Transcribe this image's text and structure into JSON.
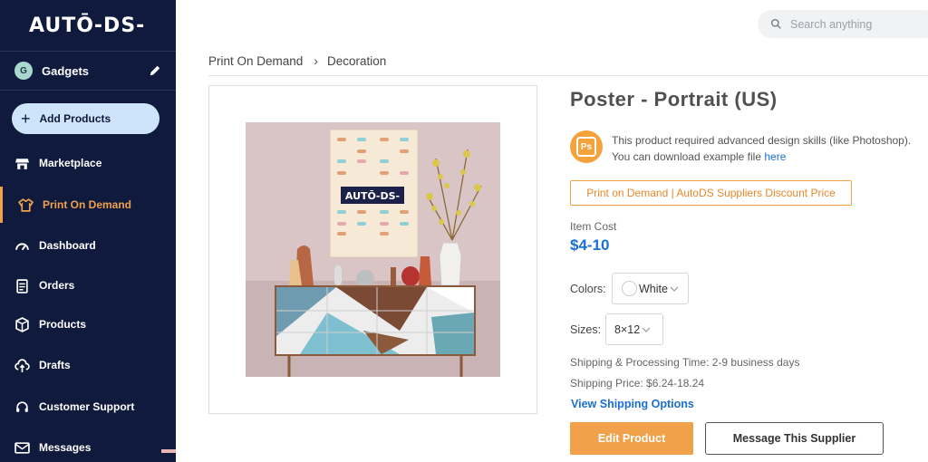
{
  "app": {
    "logo_text": "AUTŌ-DS-"
  },
  "colors": {
    "sidebar_bg": "#0f1a3d",
    "accent_orange": "#f0a14a",
    "link_blue": "#1a6fd6",
    "add_button_bg": "#cde4fb"
  },
  "sidebar": {
    "store_avatar": "G",
    "store_name": "Gadgets",
    "add_products_label": "Add Products",
    "items": [
      {
        "label": "Marketplace",
        "icon": "store-icon",
        "active": false
      },
      {
        "label": "Print On Demand",
        "icon": "shirt-icon",
        "active": true
      },
      {
        "label": "Dashboard",
        "icon": "gauge-icon",
        "active": false
      },
      {
        "label": "Orders",
        "icon": "clipboard-icon",
        "active": false
      },
      {
        "label": "Products",
        "icon": "box-icon",
        "active": false
      },
      {
        "label": "Drafts",
        "icon": "cloud-upload-icon",
        "active": false
      },
      {
        "label": "Customer Support",
        "icon": "headset-icon",
        "active": false
      },
      {
        "label": "Messages",
        "icon": "mail-icon",
        "active": false
      }
    ]
  },
  "header": {
    "search_placeholder": "Search anything"
  },
  "breadcrumb": {
    "items": [
      "Print On Demand",
      "Decoration"
    ]
  },
  "product": {
    "image_logo_text": "AUTŌ-DS-",
    "title": "Poster - Portrait (US)",
    "note_text": "This product required advanced design skills (like Photoshop).",
    "note_text2": "You can download example file ",
    "note_link": "here",
    "ps_icon_text": "Ps",
    "discount_badge": "Print on Demand | AutoDS Suppliers Discount Price",
    "cost_label": "Item Cost",
    "cost_value": "$4-10",
    "colors_label": "Colors:",
    "color_value": "White",
    "sizes_label": "Sizes:",
    "size_value": "8×12",
    "processing_time": "Shipping & Processing Time: 2-9 business days",
    "shipping_price": "Shipping Price: $6.24-18.24",
    "shipping_link": "View Shipping Options",
    "edit_button": "Edit Product",
    "message_button": "Message This Supplier"
  }
}
